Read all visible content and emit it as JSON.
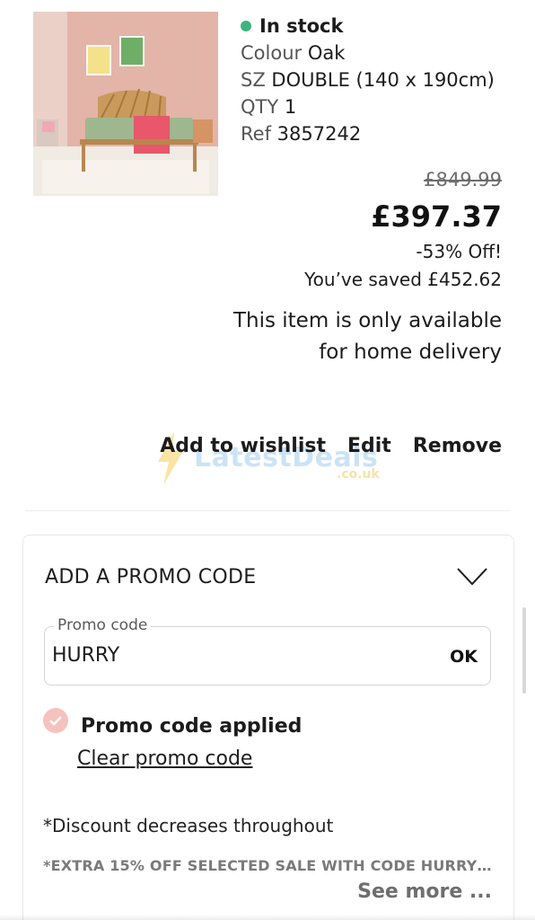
{
  "product": {
    "stock_status": "In stock",
    "stock_color": "#3db37d",
    "colour_label": "Colour",
    "colour_value": "Oak",
    "size_label": "SZ",
    "size_value": "DOUBLE (140 x 190cm)",
    "qty_label": "QTY",
    "qty_value": "1",
    "ref_label": "Ref",
    "ref_value": "3857242",
    "image_icon": "bed-product-image"
  },
  "pricing": {
    "was_price": "£849.99",
    "now_price": "£397.37",
    "discount": "-53% Off!",
    "saved": "You’ve saved £452.62",
    "delivery_note": "This item is only available for home delivery"
  },
  "actions": {
    "wishlist": "Add to wishlist",
    "edit": "Edit",
    "remove": "Remove"
  },
  "watermark": {
    "text": "LatestDeals",
    "sub": ".co.uk"
  },
  "promo": {
    "header": "ADD A PROMO CODE",
    "field_label": "Promo code",
    "field_value": "HURRY",
    "ok_label": "OK",
    "applied_text": "Promo code applied",
    "clear_label": "Clear promo code",
    "discount_note": "*Discount decreases throughout",
    "extra_note": "*EXTRA 15% OFF SELECTED SALE WITH CODE HURRY .TH...",
    "see_more": "See more ..."
  }
}
